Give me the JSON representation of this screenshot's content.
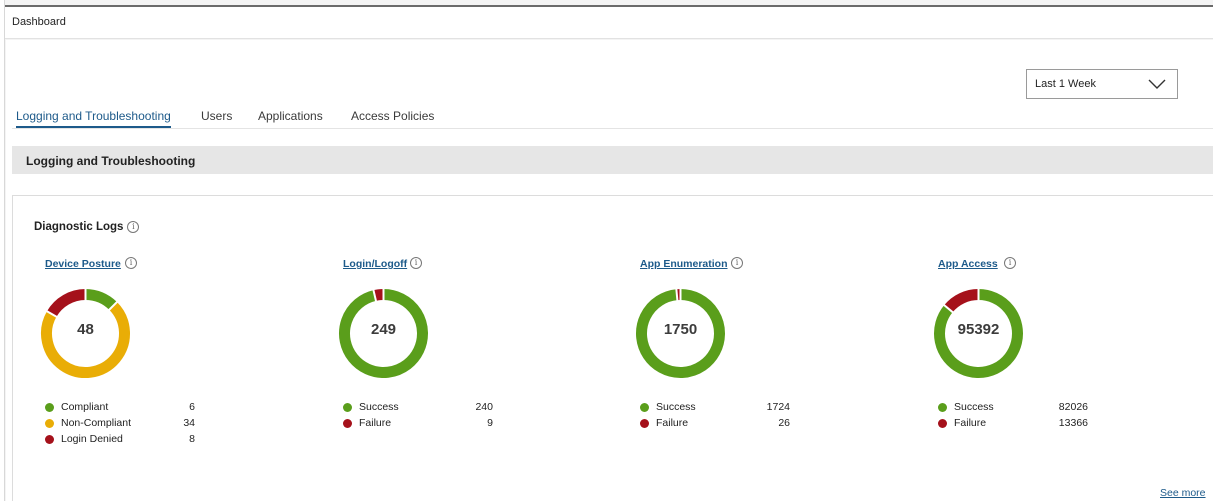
{
  "header": {
    "breadcrumb": "Dashboard"
  },
  "range": {
    "selected": "Last 1 Week"
  },
  "tabs": [
    {
      "label": "Logging and Troubleshooting"
    },
    {
      "label": "Users"
    },
    {
      "label": "Applications"
    },
    {
      "label": "Access Policies"
    }
  ],
  "section": {
    "title": "Logging and Troubleshooting"
  },
  "card": {
    "title": "Diagnostic Logs",
    "see_more": "See more"
  },
  "colors": {
    "green": "#5a9e1b",
    "yellow": "#e9ad06",
    "red": "#a5111b",
    "link": "#1d5a8a"
  },
  "metrics": [
    {
      "title": "Device Posture",
      "total": "48",
      "items": [
        {
          "label": "Compliant",
          "value": 6,
          "color": "#5a9e1b"
        },
        {
          "label": "Non-Compliant",
          "value": 34,
          "color": "#e9ad06"
        },
        {
          "label": "Login Denied",
          "value": 8,
          "color": "#a5111b"
        }
      ]
    },
    {
      "title": "Login/Logoff",
      "total": "249",
      "items": [
        {
          "label": "Success",
          "value": 240,
          "color": "#5a9e1b"
        },
        {
          "label": "Failure",
          "value": 9,
          "color": "#a5111b"
        }
      ]
    },
    {
      "title": "App Enumeration",
      "total": "1750",
      "items": [
        {
          "label": "Success",
          "value": 1724,
          "color": "#5a9e1b"
        },
        {
          "label": "Failure",
          "value": 26,
          "color": "#a5111b"
        }
      ]
    },
    {
      "title": "App Access",
      "total": "95392",
      "items": [
        {
          "label": "Success",
          "value": 82026,
          "color": "#5a9e1b"
        },
        {
          "label": "Failure",
          "value": 13366,
          "color": "#a5111b"
        }
      ]
    }
  ]
}
